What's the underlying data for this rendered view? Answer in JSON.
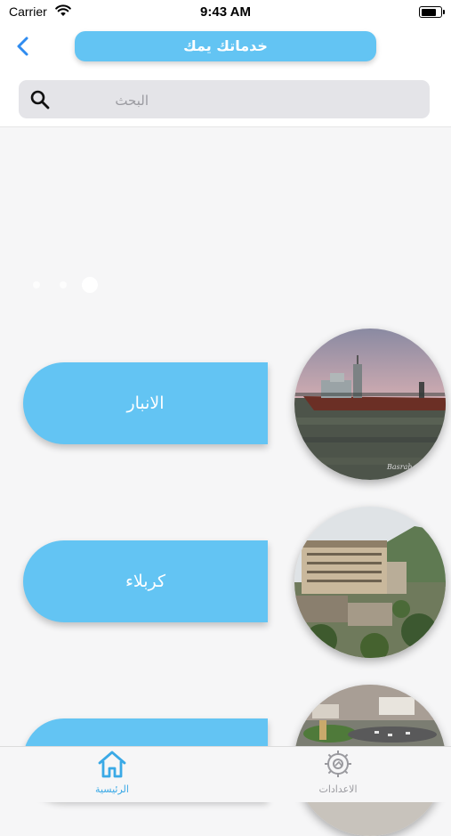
{
  "status_bar": {
    "carrier": "Carrier",
    "time": "9:43 AM",
    "battery_level": 0.9
  },
  "header": {
    "title": "خدماتك يمك"
  },
  "search": {
    "placeholder": "البحث",
    "value": ""
  },
  "carousel": {
    "page_count": 3,
    "active_index": 2
  },
  "cities": [
    {
      "name": "الانبار",
      "photo": "ship-on-river-photo"
    },
    {
      "name": "كربلاء",
      "photo": "hotel-and-mountains-photo"
    },
    {
      "name": "",
      "photo": "city-roundabout-photo"
    }
  ],
  "tabs": [
    {
      "label": "الرئيسية",
      "icon": "home-icon",
      "active": true
    },
    {
      "label": "الاعدادات",
      "icon": "gear-icon",
      "active": false
    }
  ],
  "colors": {
    "accent": "#63c4f3",
    "tab_active": "#3aa9e6",
    "tab_inactive": "#9a9a9f"
  }
}
